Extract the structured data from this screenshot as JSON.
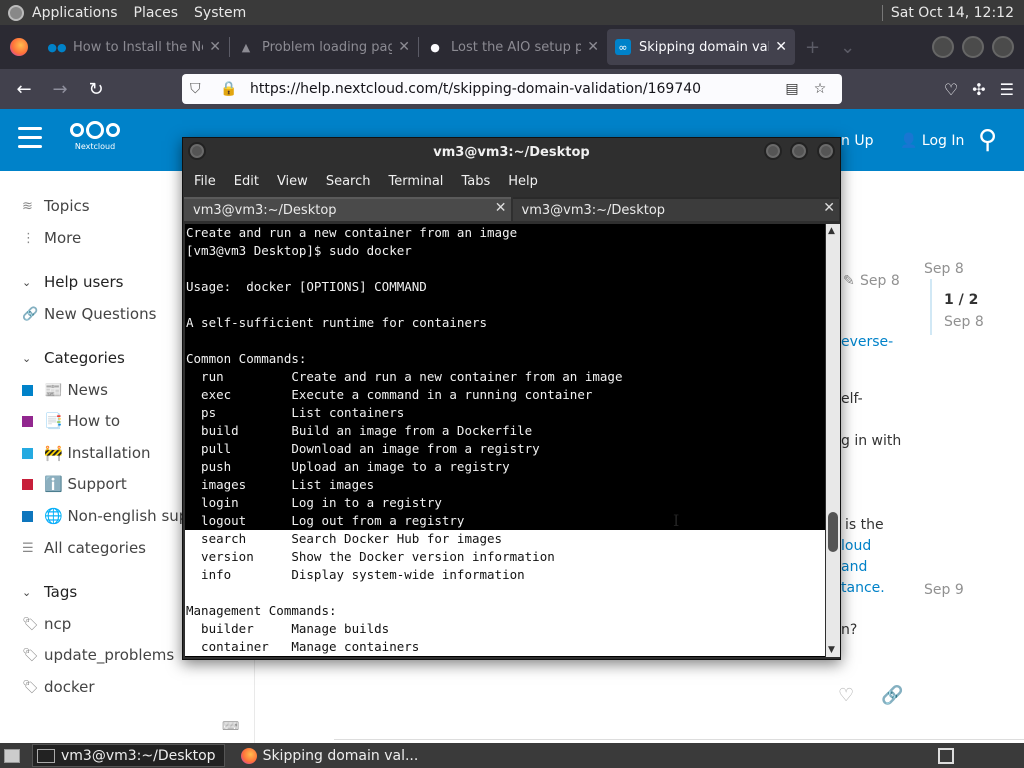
{
  "top_panel": {
    "menus": [
      "Applications",
      "Places",
      "System"
    ],
    "clock": "Sat Oct 14, 12:12"
  },
  "browser": {
    "tabs": [
      {
        "title": "How to Install the Nex",
        "active": false
      },
      {
        "title": "Problem loading page",
        "active": false
      },
      {
        "title": "Lost the AIO setup pas",
        "active": false
      },
      {
        "title": "Skipping domain valida",
        "active": true
      }
    ],
    "new_tab_label": "+",
    "tab_list_label": "⌄",
    "url": "https://help.nextcloud.com/t/skipping-domain-validation/169740"
  },
  "site": {
    "logo_text": "Nextcloud",
    "signup_label": "n Up",
    "login_label": "Log In",
    "sidebar": {
      "topics": "Topics",
      "more": "More",
      "help_users": "Help users",
      "new_questions": "New Questions",
      "categories_heading": "Categories",
      "categories": [
        {
          "label": "📰 News",
          "color": "#0082c9"
        },
        {
          "label": "📑 How to",
          "color": "#92278f"
        },
        {
          "label": "🚧 Installation",
          "color": "#25aae1"
        },
        {
          "label": "ℹ️ Support",
          "color": "#c71f3a"
        },
        {
          "label": "🌐 Non-english supp",
          "color": "#0e76bd"
        }
      ],
      "all_categories": "All categories",
      "tags_heading": "Tags",
      "tags": [
        "ncp",
        "update_problems",
        "docker"
      ]
    },
    "post_date_edit": "Sep 8",
    "timeline": {
      "top_date": "Sep 8",
      "position": "1 / 2",
      "position_date": "Sep 8",
      "bottom_date": "Sep 9"
    },
    "fragments": {
      "reverse": "everse-",
      "self": "elf-",
      "login_with": "g in with",
      "is_the": "is the",
      "cloud": "loud",
      "and": "and",
      "tance": "tance.",
      "question": "n?"
    }
  },
  "terminal": {
    "title": "vm3@vm3:~/Desktop",
    "menu": [
      "File",
      "Edit",
      "View",
      "Search",
      "Terminal",
      "Tabs",
      "Help"
    ],
    "tabs": [
      "vm3@vm3:~/Desktop",
      "vm3@vm3:~/Desktop"
    ],
    "lines_dark": [
      "Create and run a new container from an image",
      "[vm3@vm3 Desktop]$ sudo docker",
      "",
      "Usage:  docker [OPTIONS] COMMAND",
      "",
      "A self-sufficient runtime for containers",
      "",
      "Common Commands:",
      "  run         Create and run a new container from an image",
      "  exec        Execute a command in a running container",
      "  ps          List containers",
      "  build       Build an image from a Dockerfile",
      "  pull        Download an image from a registry",
      "  push        Upload an image to a registry",
      "  images      List images",
      "  login       Log in to a registry",
      "  logout      Log out from a registry"
    ],
    "lines_light": [
      "  search      Search Docker Hub for images",
      "  version     Show the Docker version information",
      "  info        Display system-wide information",
      "",
      "Management Commands:",
      "  builder     Manage builds",
      "  container   Manage containers"
    ]
  },
  "taskbar": {
    "items": [
      {
        "label": "vm3@vm3:~/Desktop",
        "active": true
      },
      {
        "label": "Skipping domain val...",
        "active": false
      }
    ]
  }
}
